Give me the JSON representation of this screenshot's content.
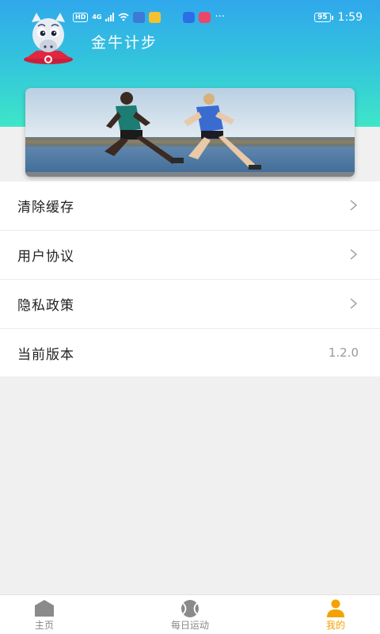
{
  "status_bar": {
    "hd": "HD",
    "network": "4G",
    "battery": "95",
    "time": "1:59",
    "dots": "···"
  },
  "header": {
    "app_title": "金牛计步"
  },
  "menu": {
    "items": [
      {
        "label": "清除缓存"
      },
      {
        "label": "用户协议"
      },
      {
        "label": "隐私政策"
      },
      {
        "label": "当前版本",
        "value": "1.2.0"
      }
    ]
  },
  "tabbar": {
    "tabs": [
      {
        "label": "主页",
        "icon": "home-icon"
      },
      {
        "label": "每日运动",
        "icon": "tennis-ball-icon"
      },
      {
        "label": "我的",
        "icon": "person-icon"
      }
    ],
    "active_index": 2,
    "active_color": "#f5a100",
    "inactive_color": "#888888"
  },
  "colors": {
    "header_top": "#30a8ec",
    "header_bottom": "#3ee6c8",
    "background": "#f0f0f0"
  }
}
